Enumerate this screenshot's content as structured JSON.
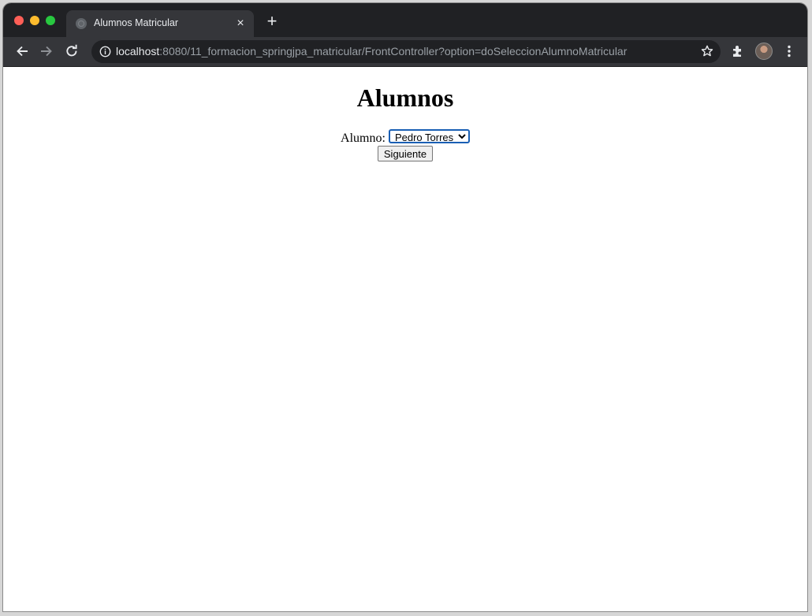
{
  "browser": {
    "tab": {
      "title": "Alumnos Matricular",
      "close_label": "×"
    },
    "new_tab_label": "+",
    "url": {
      "host": "localhost",
      "rest": ":8080/11_formacion_springjpa_matricular/FrontController?option=doSeleccionAlumnoMatricular"
    },
    "icons": [
      "back-icon",
      "forward-icon",
      "reload-icon",
      "info-icon",
      "star-icon",
      "extensions-icon",
      "profile-avatar",
      "menu-icon"
    ]
  },
  "page": {
    "heading": "Alumnos",
    "form": {
      "alumno_label": "Alumno:",
      "alumno_selected": "Pedro Torres",
      "submit_label": "Siguiente"
    }
  },
  "colors": {
    "tabstrip": "#202124",
    "toolbar": "#35363a",
    "select_focus": "#1a5fb4"
  }
}
